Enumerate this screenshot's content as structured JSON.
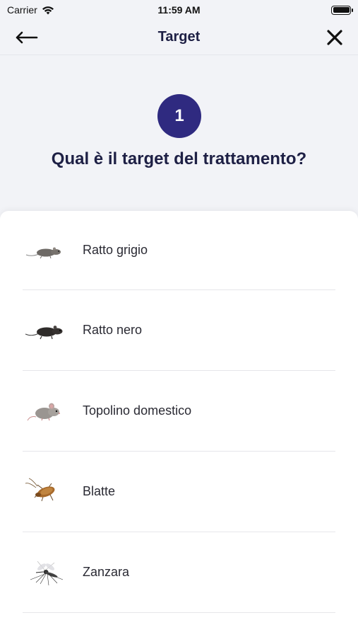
{
  "status_bar": {
    "carrier": "Carrier",
    "time": "11:59 AM"
  },
  "nav": {
    "title": "Target",
    "back_icon": "arrow-left-icon",
    "close_icon": "close-icon"
  },
  "step": {
    "number": "1",
    "question": "Qual è il target del trattamento?"
  },
  "targets": [
    {
      "label": "Ratto grigio",
      "icon": "grey-rat-icon"
    },
    {
      "label": "Ratto nero",
      "icon": "black-rat-icon"
    },
    {
      "label": "Topolino domestico",
      "icon": "house-mouse-icon"
    },
    {
      "label": "Blatte",
      "icon": "cockroach-icon"
    },
    {
      "label": "Zanzara",
      "icon": "mosquito-icon"
    }
  ],
  "colors": {
    "accent": "#2f2a80",
    "title_text": "#1e2045",
    "background": "#f2f3f7"
  }
}
